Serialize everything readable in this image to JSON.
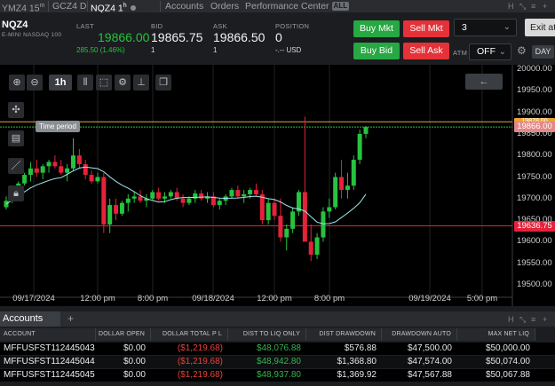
{
  "tabs": [
    {
      "label": "YMZ4 15",
      "sup": "m",
      "active": false
    },
    {
      "label": "GCZ4 D",
      "active": false
    },
    {
      "label": "NQZ4 1",
      "sup": "h",
      "active": true
    },
    {
      "label": "Accounts",
      "active": false
    },
    {
      "label": "Orders",
      "active": false
    },
    {
      "label": "Performance Center",
      "active": false,
      "badge": "ALL"
    }
  ],
  "quote": {
    "symbol": "NQZ4",
    "exchange": "E-MINI NASDAQ 100",
    "last_label": "LAST",
    "last": "19866.00",
    "change": "285.50 (1.46%)",
    "bid_label": "BID",
    "bid": "19865.75",
    "bid_size": "1",
    "ask_label": "ASK",
    "ask": "19866.50",
    "ask_size": "1",
    "position_label": "POSITION",
    "position": "0",
    "position_pl": "-.-- USD"
  },
  "order_panel": {
    "buy_mkt": "Buy Mkt",
    "sell_mkt": "Sell Mkt",
    "buy_bid": "Buy Bid",
    "sell_ask": "Sell Ask",
    "quantity": "3",
    "atm_label": "ATM",
    "atm_value": "OFF",
    "day": "DAY",
    "exit": "Exit at"
  },
  "chart": {
    "tooltip": "Time period",
    "period_button": "1h",
    "price_tags": {
      "last": "19866.00",
      "line": "19636.75",
      "upper": "19878.00"
    },
    "colors": {
      "up": "#27c33f",
      "down": "#e5223a",
      "ma": "#9fe6ef"
    }
  },
  "chart_data": {
    "type": "candlestick",
    "y_ticks": [
      "20000.00",
      "19950.00",
      "19900.00",
      "19850.00",
      "19800.00",
      "19750.00",
      "19700.00",
      "19650.00",
      "19600.00",
      "19550.00",
      "19500.00"
    ],
    "x_ticks": [
      "09/17/2024",
      "12:00 pm",
      "8:00 pm",
      "09/18/2024",
      "12:00 pm",
      "8:00 pm",
      "09/19/2024",
      "5:00 pm"
    ],
    "ylim": [
      19480,
      20010
    ],
    "candles": [
      [
        19680,
        19705,
        19675,
        19695
      ],
      [
        19695,
        19720,
        19690,
        19715
      ],
      [
        19715,
        19740,
        19710,
        19735
      ],
      [
        19735,
        19760,
        19730,
        19755
      ],
      [
        19755,
        19785,
        19740,
        19770
      ],
      [
        19770,
        19790,
        19750,
        19760
      ],
      [
        19760,
        19780,
        19745,
        19775
      ],
      [
        19775,
        19790,
        19760,
        19785
      ],
      [
        19785,
        19800,
        19770,
        19775
      ],
      [
        19775,
        19790,
        19755,
        19760
      ],
      [
        19760,
        19780,
        19740,
        19770
      ],
      [
        19770,
        19840,
        19765,
        19800
      ],
      [
        19800,
        19815,
        19770,
        19780
      ],
      [
        19780,
        19790,
        19745,
        19755
      ],
      [
        19755,
        19765,
        19735,
        19740
      ],
      [
        19740,
        19760,
        19735,
        19750
      ],
      [
        19750,
        19760,
        19620,
        19640
      ],
      [
        19640,
        19700,
        19620,
        19685
      ],
      [
        19685,
        19700,
        19650,
        19665
      ],
      [
        19665,
        19695,
        19660,
        19690
      ],
      [
        19690,
        19710,
        19670,
        19700
      ],
      [
        19700,
        19715,
        19690,
        19705
      ],
      [
        19705,
        19720,
        19690,
        19695
      ],
      [
        19695,
        19710,
        19680,
        19700
      ],
      [
        19700,
        19720,
        19695,
        19715
      ],
      [
        19715,
        19725,
        19695,
        19700
      ],
      [
        19700,
        19715,
        19690,
        19705
      ],
      [
        19705,
        19720,
        19700,
        19715
      ],
      [
        19715,
        19725,
        19695,
        19700
      ],
      [
        19700,
        19710,
        19680,
        19690
      ],
      [
        19690,
        19705,
        19685,
        19700
      ],
      [
        19700,
        19720,
        19690,
        19712
      ],
      [
        19712,
        19720,
        19695,
        19700
      ],
      [
        19700,
        19715,
        19690,
        19705
      ],
      [
        19705,
        19715,
        19680,
        19685
      ],
      [
        19685,
        19700,
        19675,
        19695
      ],
      [
        19695,
        19710,
        19685,
        19705
      ],
      [
        19705,
        19725,
        19700,
        19720
      ],
      [
        19720,
        19730,
        19700,
        19705
      ],
      [
        19705,
        19720,
        19690,
        19710
      ],
      [
        19710,
        19725,
        19700,
        19720
      ],
      [
        19720,
        19735,
        19705,
        19710
      ],
      [
        19710,
        19720,
        19640,
        19650
      ],
      [
        19650,
        19700,
        19640,
        19690
      ],
      [
        19690,
        19700,
        19650,
        19660
      ],
      [
        19660,
        19700,
        19600,
        19610
      ],
      [
        19610,
        19640,
        19580,
        19630
      ],
      [
        19630,
        19680,
        19620,
        19670
      ],
      [
        19670,
        19720,
        19660,
        19715
      ],
      [
        19715,
        19890,
        19700,
        19600
      ],
      [
        19600,
        19640,
        19555,
        19570
      ],
      [
        19570,
        19620,
        19560,
        19610
      ],
      [
        19610,
        19680,
        19600,
        19670
      ],
      [
        19670,
        19700,
        19655,
        19680
      ],
      [
        19680,
        19760,
        19675,
        19750
      ],
      [
        19750,
        19790,
        19700,
        19720
      ],
      [
        19720,
        19760,
        19700,
        19730
      ],
      [
        19730,
        19800,
        19720,
        19790
      ],
      [
        19790,
        19860,
        19780,
        19850
      ],
      [
        19850,
        19868,
        19840,
        19866
      ]
    ]
  },
  "accounts": {
    "panel_title": "Accounts",
    "columns": [
      "ACCOUNT",
      "DOLLAR OPEN",
      "DOLLAR TOTAL P L",
      "DIST TO LIQ ONLY",
      "DIST DRAWDOWN",
      "DRAWDOWN AUTO",
      "MAX NET LIQ"
    ],
    "rows": [
      [
        "MFFUSFST112445043",
        "$0.00",
        "($1,219.68)",
        "$48,076.88",
        "$576.88",
        "$47,500.00",
        "$50,000.00"
      ],
      [
        "MFFUSFST112445044",
        "$0.00",
        "($1,219.68)",
        "$48,942.80",
        "$1,368.80",
        "$47,574.00",
        "$50,074.00"
      ],
      [
        "MFFUSFST112445045",
        "$0.00",
        "($1,219.68)",
        "$48,937.80",
        "$1,369.92",
        "$47,567.88",
        "$50,067.88"
      ]
    ]
  }
}
